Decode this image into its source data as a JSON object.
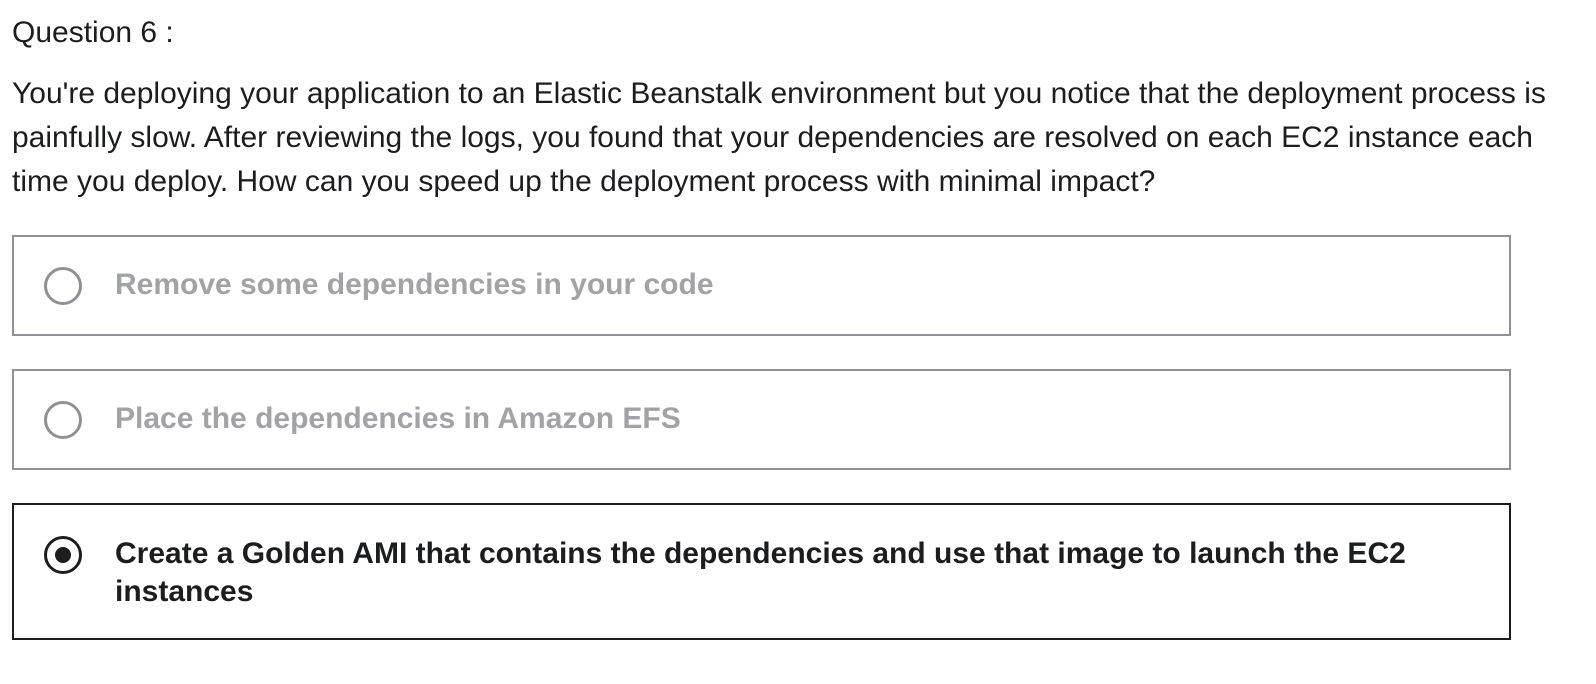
{
  "question": {
    "header": "Question 6 :",
    "text": "You're deploying your application to an Elastic Beanstalk environment but you notice that the deployment process is painfully slow. After reviewing the logs, you found that your dependencies are resolved on each EC2 instance each time you deploy. How can you speed up the deployment process with minimal impact?"
  },
  "options": [
    {
      "label": "Remove some dependencies in your code",
      "selected": false
    },
    {
      "label": "Place the dependencies in Amazon EFS",
      "selected": false
    },
    {
      "label": "Create a Golden AMI that contains the dependencies and use that image to launch the EC2 instances",
      "selected": true
    }
  ],
  "colors": {
    "text": "#1c1d1f",
    "muted": "#a1a3a7",
    "border": "#8f9196",
    "selected_border": "#1c1d1f"
  }
}
